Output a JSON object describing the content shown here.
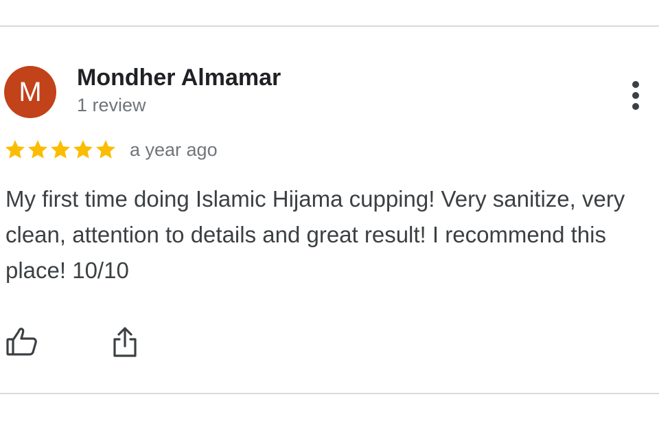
{
  "reviewer": {
    "initial": "M",
    "name": "Mondher Almamar",
    "review_count": "1 review",
    "avatar_color": "#c2421a"
  },
  "rating": {
    "stars": 5,
    "max_stars": 5,
    "star_color": "#fbbc04",
    "time": "a year ago"
  },
  "review": {
    "text": "My first time doing Islamic Hijama cupping! Very sanitize, very clean, attention to details and great result! I recommend this place! 10/10"
  },
  "actions": {
    "like_icon": "thumbs-up-icon",
    "share_icon": "share-icon",
    "more_icon": "more-vert-icon"
  }
}
